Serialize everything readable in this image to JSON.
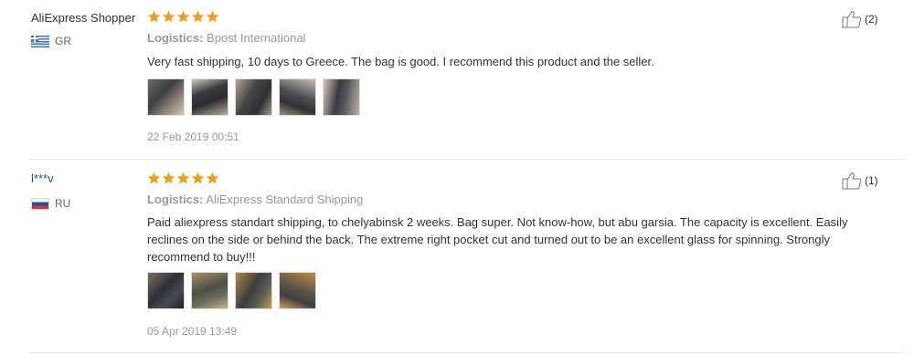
{
  "reviews": [
    {
      "name": "AliExpress Shopper",
      "country": "GR",
      "stars": 5,
      "logistics_label": "Logistics:",
      "logistics": "Bpost International",
      "text": "Very fast shipping, 10 days to Greece. The bag is good. I recommend this product and the seller.",
      "date": "22 Feb 2019 00:51",
      "likes": "(2)",
      "photos": [
        "photo-1",
        "photo-2",
        "photo-3",
        "photo-4",
        "photo-5"
      ]
    },
    {
      "name": "l***v",
      "country": "RU",
      "stars": 5,
      "logistics_label": "Logistics:",
      "logistics": "AliExpress Standard Shipping",
      "text": "Paid aliexpress standart shipping, to chelyabinsk 2 weeks. Bag super. Not know-how, but abu garsia. The capacity is excellent. Easily reclines on the side or behind the back. The extreme right pocket cut and turned out to be an excellent glass for spinning. Strongly recommend to buy!!!",
      "date": "05 Apr 2019 13:49",
      "likes": "(1)",
      "photos": [
        "photo-1",
        "photo-2",
        "photo-3",
        "photo-4"
      ]
    }
  ],
  "colors": {
    "star": "#f39c12",
    "link": "#1a56b0",
    "muted": "#999999"
  },
  "icons": {
    "star": "star-icon",
    "like": "thumbs-up-icon"
  }
}
